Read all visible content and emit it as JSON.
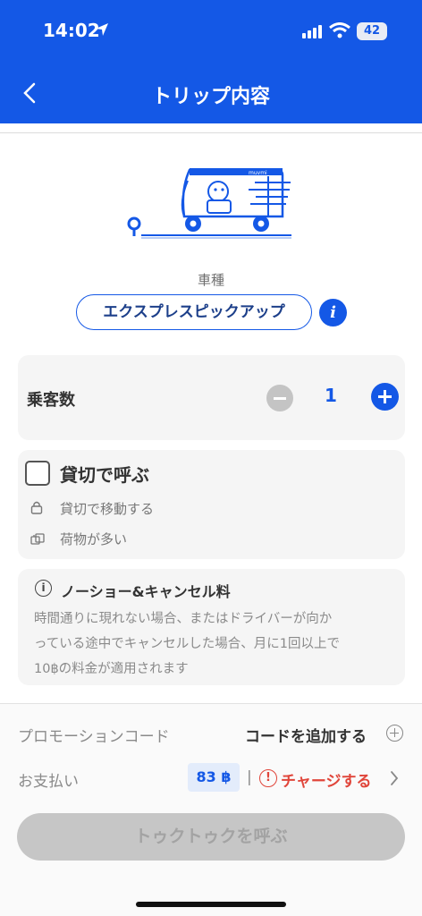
{
  "status_bar": {
    "time": "14:02",
    "battery": "42"
  },
  "nav": {
    "title": "トリップ内容"
  },
  "vehicle": {
    "label": "車種",
    "type": "エクスプレスピックアップ",
    "info_glyph": "i",
    "brand_on_vehicle": "muvmi"
  },
  "passengers": {
    "label": "乗客数",
    "count": "1"
  },
  "charter": {
    "title": "貸切で呼ぶ",
    "options": [
      "貸切で移動する",
      "荷物が多い"
    ]
  },
  "notice": {
    "icon_glyph": "i",
    "title": "ノーショー&キャンセル料",
    "lines": [
      "時間通りに現れない場合、またはドライバーが向か",
      "っている途中でキャンセルした場合、月に1回以上で",
      "10฿の料金が適用されます"
    ]
  },
  "promo": {
    "label": "プロモーションコード",
    "action": "コードを追加する"
  },
  "payment": {
    "label": "お支払い",
    "balance": "83 ฿",
    "separator": "|",
    "warn_glyph": "!",
    "charge_label": "チャージする"
  },
  "cta": {
    "label": "トゥクトゥクを呼ぶ"
  },
  "colors": {
    "primary": "#1458e6",
    "alert": "#e0453a",
    "disabled_button": "#c6c6c6"
  }
}
